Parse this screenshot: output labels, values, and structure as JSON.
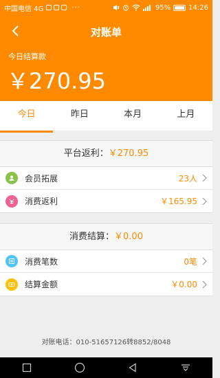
{
  "statusbar": {
    "carrier": "中国电信 4G",
    "battery": "95%",
    "time": "14:26"
  },
  "header": {
    "title": "对账单",
    "subtitle": "今日结算款",
    "amount": "￥270.95"
  },
  "tabs": [
    {
      "label": "今日"
    },
    {
      "label": "昨日"
    },
    {
      "label": "本月"
    },
    {
      "label": "上月"
    }
  ],
  "rebate": {
    "label": "平台返利：",
    "value": "￥270.95",
    "rows": [
      {
        "label": "会员拓展",
        "value": "23人",
        "icon": "member-icon",
        "color": "#8bc34a"
      },
      {
        "label": "消费返利",
        "value": "￥165.95",
        "icon": "rebate-icon",
        "color": "#f06292"
      }
    ]
  },
  "settlement": {
    "label": "消费结算：",
    "value": "￥0.00",
    "rows": [
      {
        "label": "消费笔数",
        "value": "0笔",
        "icon": "count-icon",
        "color": "#4fc3f7"
      },
      {
        "label": "结算金额",
        "value": "￥0.00",
        "icon": "amount-icon",
        "color": "#ffc107"
      }
    ]
  },
  "footer": {
    "phone": "对账电话：010-51657126转8852/8048"
  }
}
